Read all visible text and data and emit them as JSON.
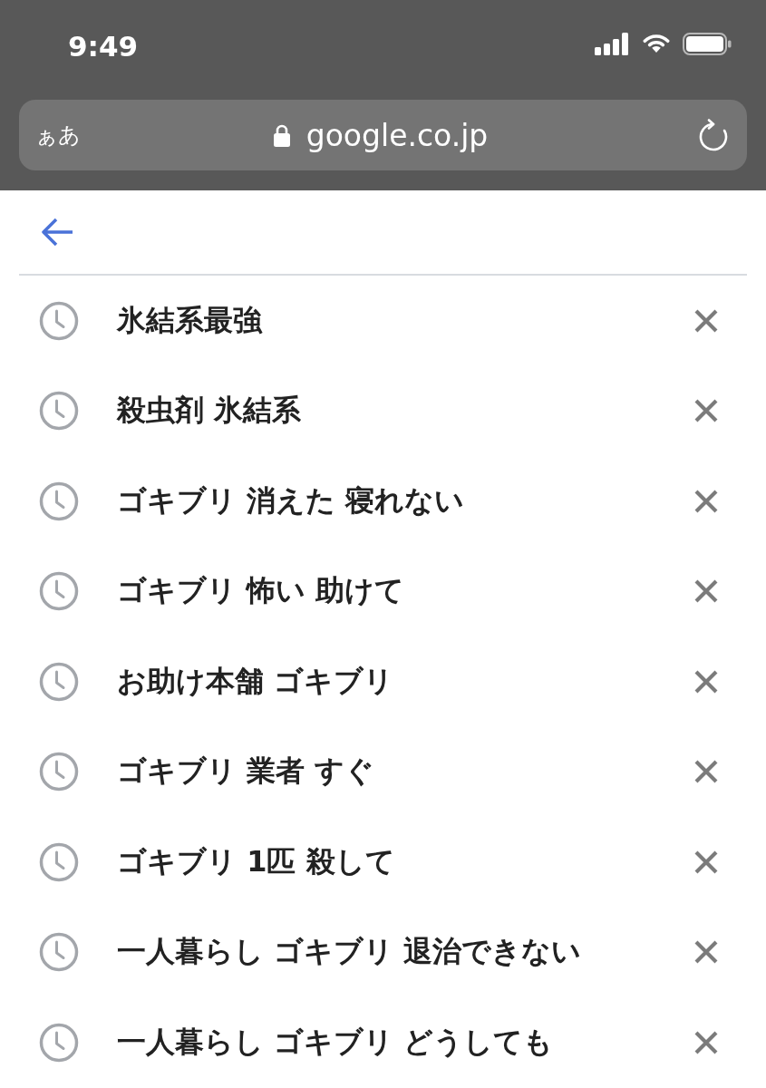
{
  "status_bar": {
    "time": "9:49"
  },
  "address_bar": {
    "text_size_button": "ぁあ",
    "secure": true,
    "url": "google.co.jp"
  },
  "search_history": [
    {
      "query": "氷結系最強"
    },
    {
      "query": "殺虫剤 氷結系"
    },
    {
      "query": "ゴキブリ 消えた 寝れない"
    },
    {
      "query": "ゴキブリ 怖い 助けて"
    },
    {
      "query": "お助け本舗 ゴキブリ"
    },
    {
      "query": "ゴキブリ 業者 すぐ"
    },
    {
      "query": "ゴキブリ 1匹 殺して"
    },
    {
      "query": "一人暮らし ゴキブリ 退治できない"
    },
    {
      "query": "一人暮らし ゴキブリ どうしても"
    }
  ]
}
